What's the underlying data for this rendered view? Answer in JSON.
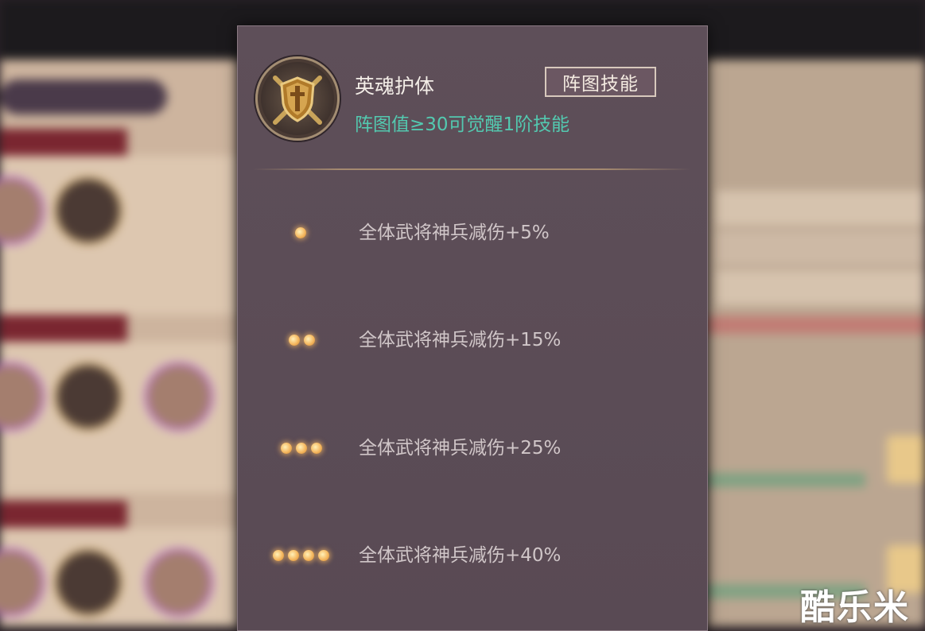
{
  "skill": {
    "name": "英魂护体",
    "type_label": "阵图技能",
    "condition": "阵图值≥30可觉醒1阶技能",
    "emblem_icon": "shield-crossed-swords-icon"
  },
  "levels": [
    {
      "dots": 1,
      "effect": "全体武将神兵减伤+5%"
    },
    {
      "dots": 2,
      "effect": "全体武将神兵减伤+15%"
    },
    {
      "dots": 3,
      "effect": "全体武将神兵减伤+25%"
    },
    {
      "dots": 4,
      "effect": "全体武将神兵减伤+40%"
    }
  ],
  "watermark": "酷乐米",
  "colors": {
    "condition_text": "#53c9b0",
    "panel_bg": "#5e4f59",
    "dot_glow": "#f5b860"
  }
}
